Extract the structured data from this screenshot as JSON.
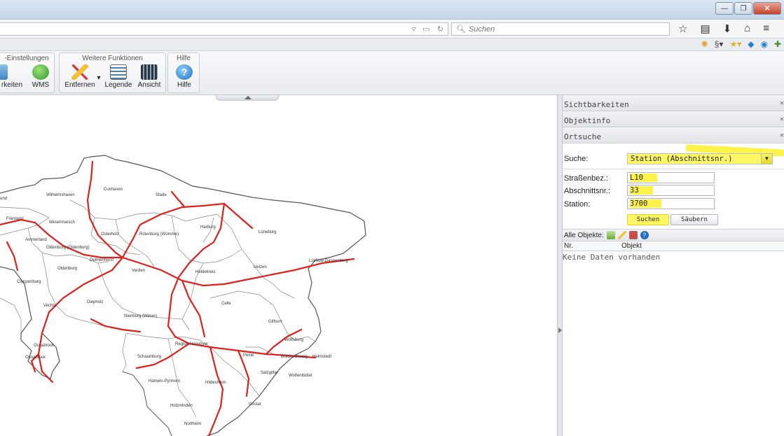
{
  "browser": {
    "search_placeholder": "Suchen",
    "window_buttons": [
      "—",
      "❐",
      "✕"
    ]
  },
  "ribbon": {
    "groups": [
      {
        "title": "-Einstellungen"
      },
      {
        "title": "Weitere Funktionen"
      },
      {
        "title": "Hilfe"
      }
    ],
    "tools": {
      "sichtbarkeiten": "rkeiten",
      "wms": "WMS",
      "entfernen": "Entfernen",
      "legende": "Legende",
      "ansicht": "Ansicht",
      "hilfe": "Hilfe"
    }
  },
  "map": {
    "places": [
      "und",
      "Wesermarsch",
      "Wilhelmshaven",
      "Cuxhaven",
      "Stade",
      "Friesland",
      "Ammerland",
      "Oldenburg (Oldenburg)",
      "Osterholz",
      "Rotenburg (Wümme)",
      "Harburg",
      "Lüneburg",
      "Delmenhorst",
      "Oldenburg",
      "Verden",
      "Heidekreis",
      "Uelzen",
      "Lüchow-Dannenberg",
      "Cloppenburg",
      "Vechta",
      "Diepholz",
      "Nienburg (Weser)",
      "Celle",
      "Gifhorn",
      "Wolfsburg",
      "Osnabrück",
      "Osnabrück",
      "Region Hannover",
      "Schaumburg",
      "Peine",
      "Braunschweig",
      "Helmstedt",
      "Salzgitter",
      "Wolfenbüttel",
      "Hameln-Pyrmont",
      "Hildesheim",
      "Holzminden",
      "Goslar",
      "Northeim"
    ]
  },
  "panel": {
    "sections": [
      "Sichtbarkeiten",
      "Objektinfo",
      "Ortsuche"
    ],
    "close_glyph": "✕",
    "search_label": "Suche:",
    "search_mode": "Station (Abschnittsnr.)",
    "fields": {
      "strasse_label": "Straßenbez.:",
      "strasse_value": "L10",
      "abschnitt_label": "Abschnittsnr.:",
      "abschnitt_value": "33",
      "station_label": "Station:",
      "station_value": "3700"
    },
    "buttons": {
      "suchen": "Suchen",
      "saubern": "Säubern"
    },
    "objects_label": "Alle Objekte:",
    "columns": [
      "Nr.",
      "Objekt"
    ],
    "empty_text": "Keine Daten vorhanden"
  }
}
